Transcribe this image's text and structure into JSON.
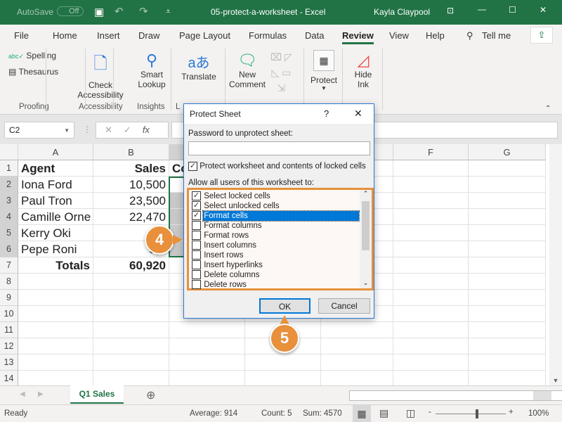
{
  "titlebar": {
    "autosave": "AutoSave",
    "autosave_state": "Off",
    "title": "05-protect-a-worksheet  -  Excel",
    "user": "Kayla Claypool"
  },
  "tabs": [
    "File",
    "Home",
    "Insert",
    "Draw",
    "Page Layout",
    "Formulas",
    "Data",
    "Review",
    "View",
    "Help",
    "Tell me"
  ],
  "active_tab": "Review",
  "ribbon": {
    "spelling": "Spelling",
    "thesaurus": "Thesaurus",
    "proofing": "Proofing",
    "check1": "Check",
    "check2": "Accessibility",
    "accessibility": "Accessibility",
    "smart1": "Smart",
    "smart2": "Lookup",
    "insights": "Insights",
    "translate": "Translate",
    "lang": "L",
    "new1": "New",
    "new2": "Comment",
    "protect": "Protect",
    "hide1": "Hide",
    "hide2": "Ink"
  },
  "formula_bar": {
    "name_box": "C2",
    "fx": "fx"
  },
  "columns": [
    "A",
    "B",
    "C",
    "D",
    "E",
    "F",
    "G"
  ],
  "rows": [
    "1",
    "2",
    "3",
    "4",
    "5",
    "6",
    "7",
    "8",
    "9",
    "10",
    "11",
    "12",
    "13",
    "14"
  ],
  "cells": [
    [
      "Agent",
      "Sales",
      "Co"
    ],
    [
      "Iona Ford",
      "10,500",
      ""
    ],
    [
      "Paul Tron",
      "23,500",
      ""
    ],
    [
      "Camille Orne",
      "22,470",
      ""
    ],
    [
      "Kerry Oki",
      "9",
      ""
    ],
    [
      "Pepe Roni",
      "3,5",
      ""
    ],
    [
      "Totals",
      "60,920",
      ""
    ]
  ],
  "dialog": {
    "title": "Protect Sheet",
    "help": "?",
    "password_label": "Password to unprotect sheet:",
    "password_value": "",
    "protect_label": "Protect worksheet and contents of locked cells",
    "protect_checked": true,
    "allow_label": "Allow all users of this worksheet to:",
    "items": [
      {
        "label": "Select locked cells",
        "checked": true
      },
      {
        "label": "Select unlocked cells",
        "checked": true
      },
      {
        "label": "Format cells",
        "checked": true,
        "selected": true
      },
      {
        "label": "Format columns",
        "checked": false
      },
      {
        "label": "Format rows",
        "checked": false
      },
      {
        "label": "Insert columns",
        "checked": false
      },
      {
        "label": "Insert rows",
        "checked": false
      },
      {
        "label": "Insert hyperlinks",
        "checked": false
      },
      {
        "label": "Delete columns",
        "checked": false
      },
      {
        "label": "Delete rows",
        "checked": false
      }
    ],
    "ok": "OK",
    "cancel": "Cancel"
  },
  "callouts": {
    "step4": "4",
    "step5": "5"
  },
  "sheet_tab": "Q1 Sales",
  "status": {
    "ready": "Ready",
    "average": "Average: 914",
    "count": "Count: 5",
    "sum": "Sum: 4570",
    "zoom": "100%"
  },
  "colors": {
    "excel_green": "#217346",
    "callout": "#e8903b",
    "highlight": "#0078d7"
  }
}
